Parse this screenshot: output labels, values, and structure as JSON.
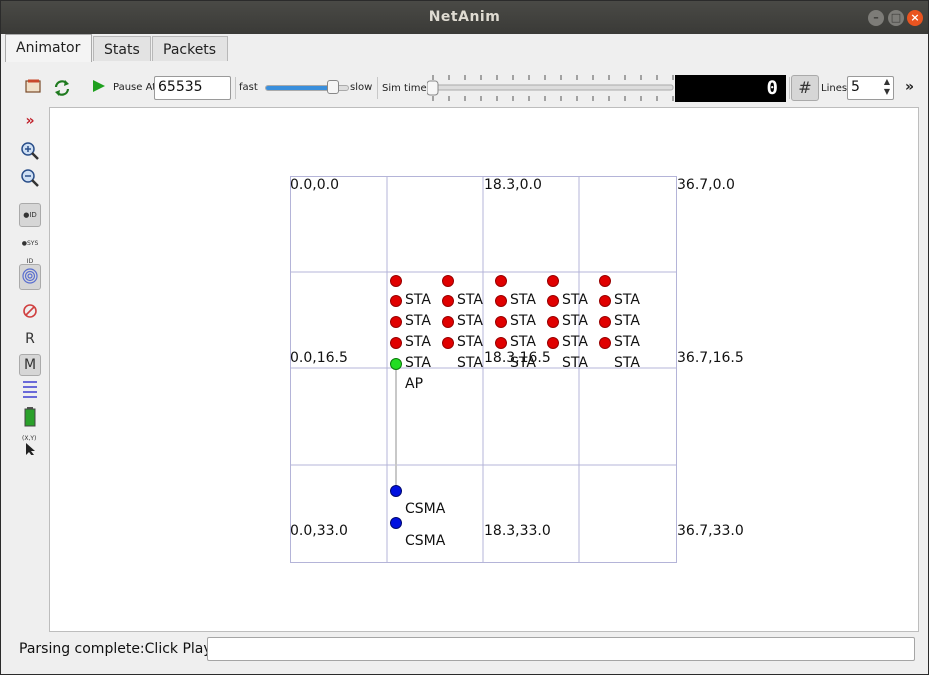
{
  "window": {
    "title": "NetAnim"
  },
  "tabs": [
    {
      "label": "Animator"
    },
    {
      "label": "Stats"
    },
    {
      "label": "Packets"
    }
  ],
  "toolbar": {
    "pause_at_label": "Pause At",
    "pause_at_value": "65535",
    "fast_label": "fast",
    "slow_label": "slow",
    "sim_time_label": "Sim time",
    "sim_time_display": "0",
    "lines_label": "Lines",
    "lines_value": "5",
    "overflow": "»"
  },
  "left_toolbar": {
    "r_label": "R",
    "m_label": "M"
  },
  "canvas": {
    "grid_labels": [
      "0.0,0.0",
      "18.3,0.0",
      "36.7,0.0",
      "0.0,16.5",
      "18.3,16.5",
      "36.7,16.5",
      "0.0,33.0",
      "18.3,33.0",
      "36.7,33.0"
    ],
    "sta_label": "STA",
    "ap_label": "AP",
    "csma_label": "CSMA"
  },
  "status": {
    "text": "Parsing complete:Click Play"
  },
  "colors": {
    "sta_node": "#e00000",
    "ap_node": "#22dd22",
    "csma_node": "#0010e0",
    "close_button": "#e95420"
  }
}
